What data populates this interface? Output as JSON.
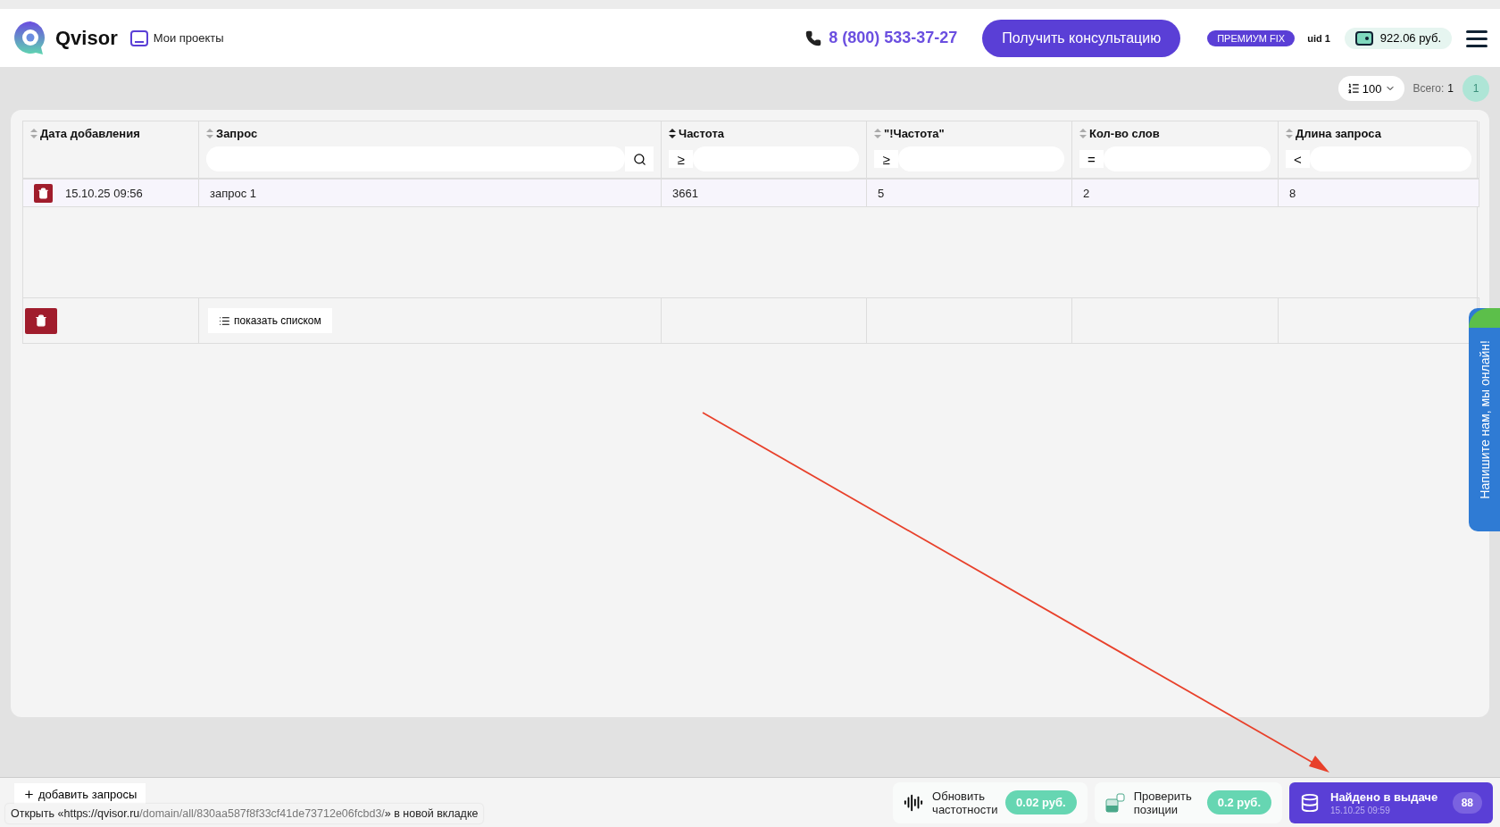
{
  "header": {
    "brand": "Qvisor",
    "projects_link": "Мои проекты",
    "phone": "8 (800) 533-37-27",
    "consult_button": "Получить консультацию",
    "plan_badge": "ПРЕМИУМ FIX",
    "uid": "uid 1",
    "balance": "922.06 руб."
  },
  "toolbar": {
    "per_page": "100",
    "total_label": "Всего:",
    "total": "1",
    "pages": [
      {
        "label": "1",
        "selected": true
      }
    ]
  },
  "table": {
    "columns": [
      {
        "label": "Дата добавления",
        "sorted": false,
        "kind": "plain"
      },
      {
        "label": "Запрос",
        "sorted": false,
        "kind": "search"
      },
      {
        "label": "Частота",
        "sorted": true,
        "kind": "operator",
        "operator": "≥"
      },
      {
        "label": "\"!Частота\"",
        "sorted": false,
        "kind": "operator",
        "operator": "≥"
      },
      {
        "label": "Кол-во слов",
        "sorted": false,
        "kind": "operator",
        "operator": "="
      },
      {
        "label": "Длина запроса",
        "sorted": false,
        "kind": "operator",
        "operator": "<"
      }
    ],
    "rows": [
      {
        "cells": [
          "15.10.25 09:56",
          "запрос 1",
          "3661",
          "5",
          "2",
          "8"
        ]
      }
    ],
    "show_list_button": "показать списком"
  },
  "chat_tab": "Напишите нам, мы онлайн!",
  "bottom_bar": {
    "add_button": "добавить запросы",
    "actions": [
      {
        "kind": "freq",
        "label": "Обновить частотности",
        "price": "0.02 руб."
      },
      {
        "kind": "positions",
        "label": "Проверить позиции",
        "price": "0.2 руб."
      }
    ],
    "found": {
      "title": "Найдено в выдаче",
      "date": "15.10.25 09:59",
      "count": "88"
    }
  },
  "status_tooltip": {
    "prefix": "Открыть «",
    "host": "https://qvisor.ru",
    "path": "/domain/all/830aa587f8f33cf41de73712e06fcbd3/",
    "suffix": "» в новой вкладке"
  }
}
